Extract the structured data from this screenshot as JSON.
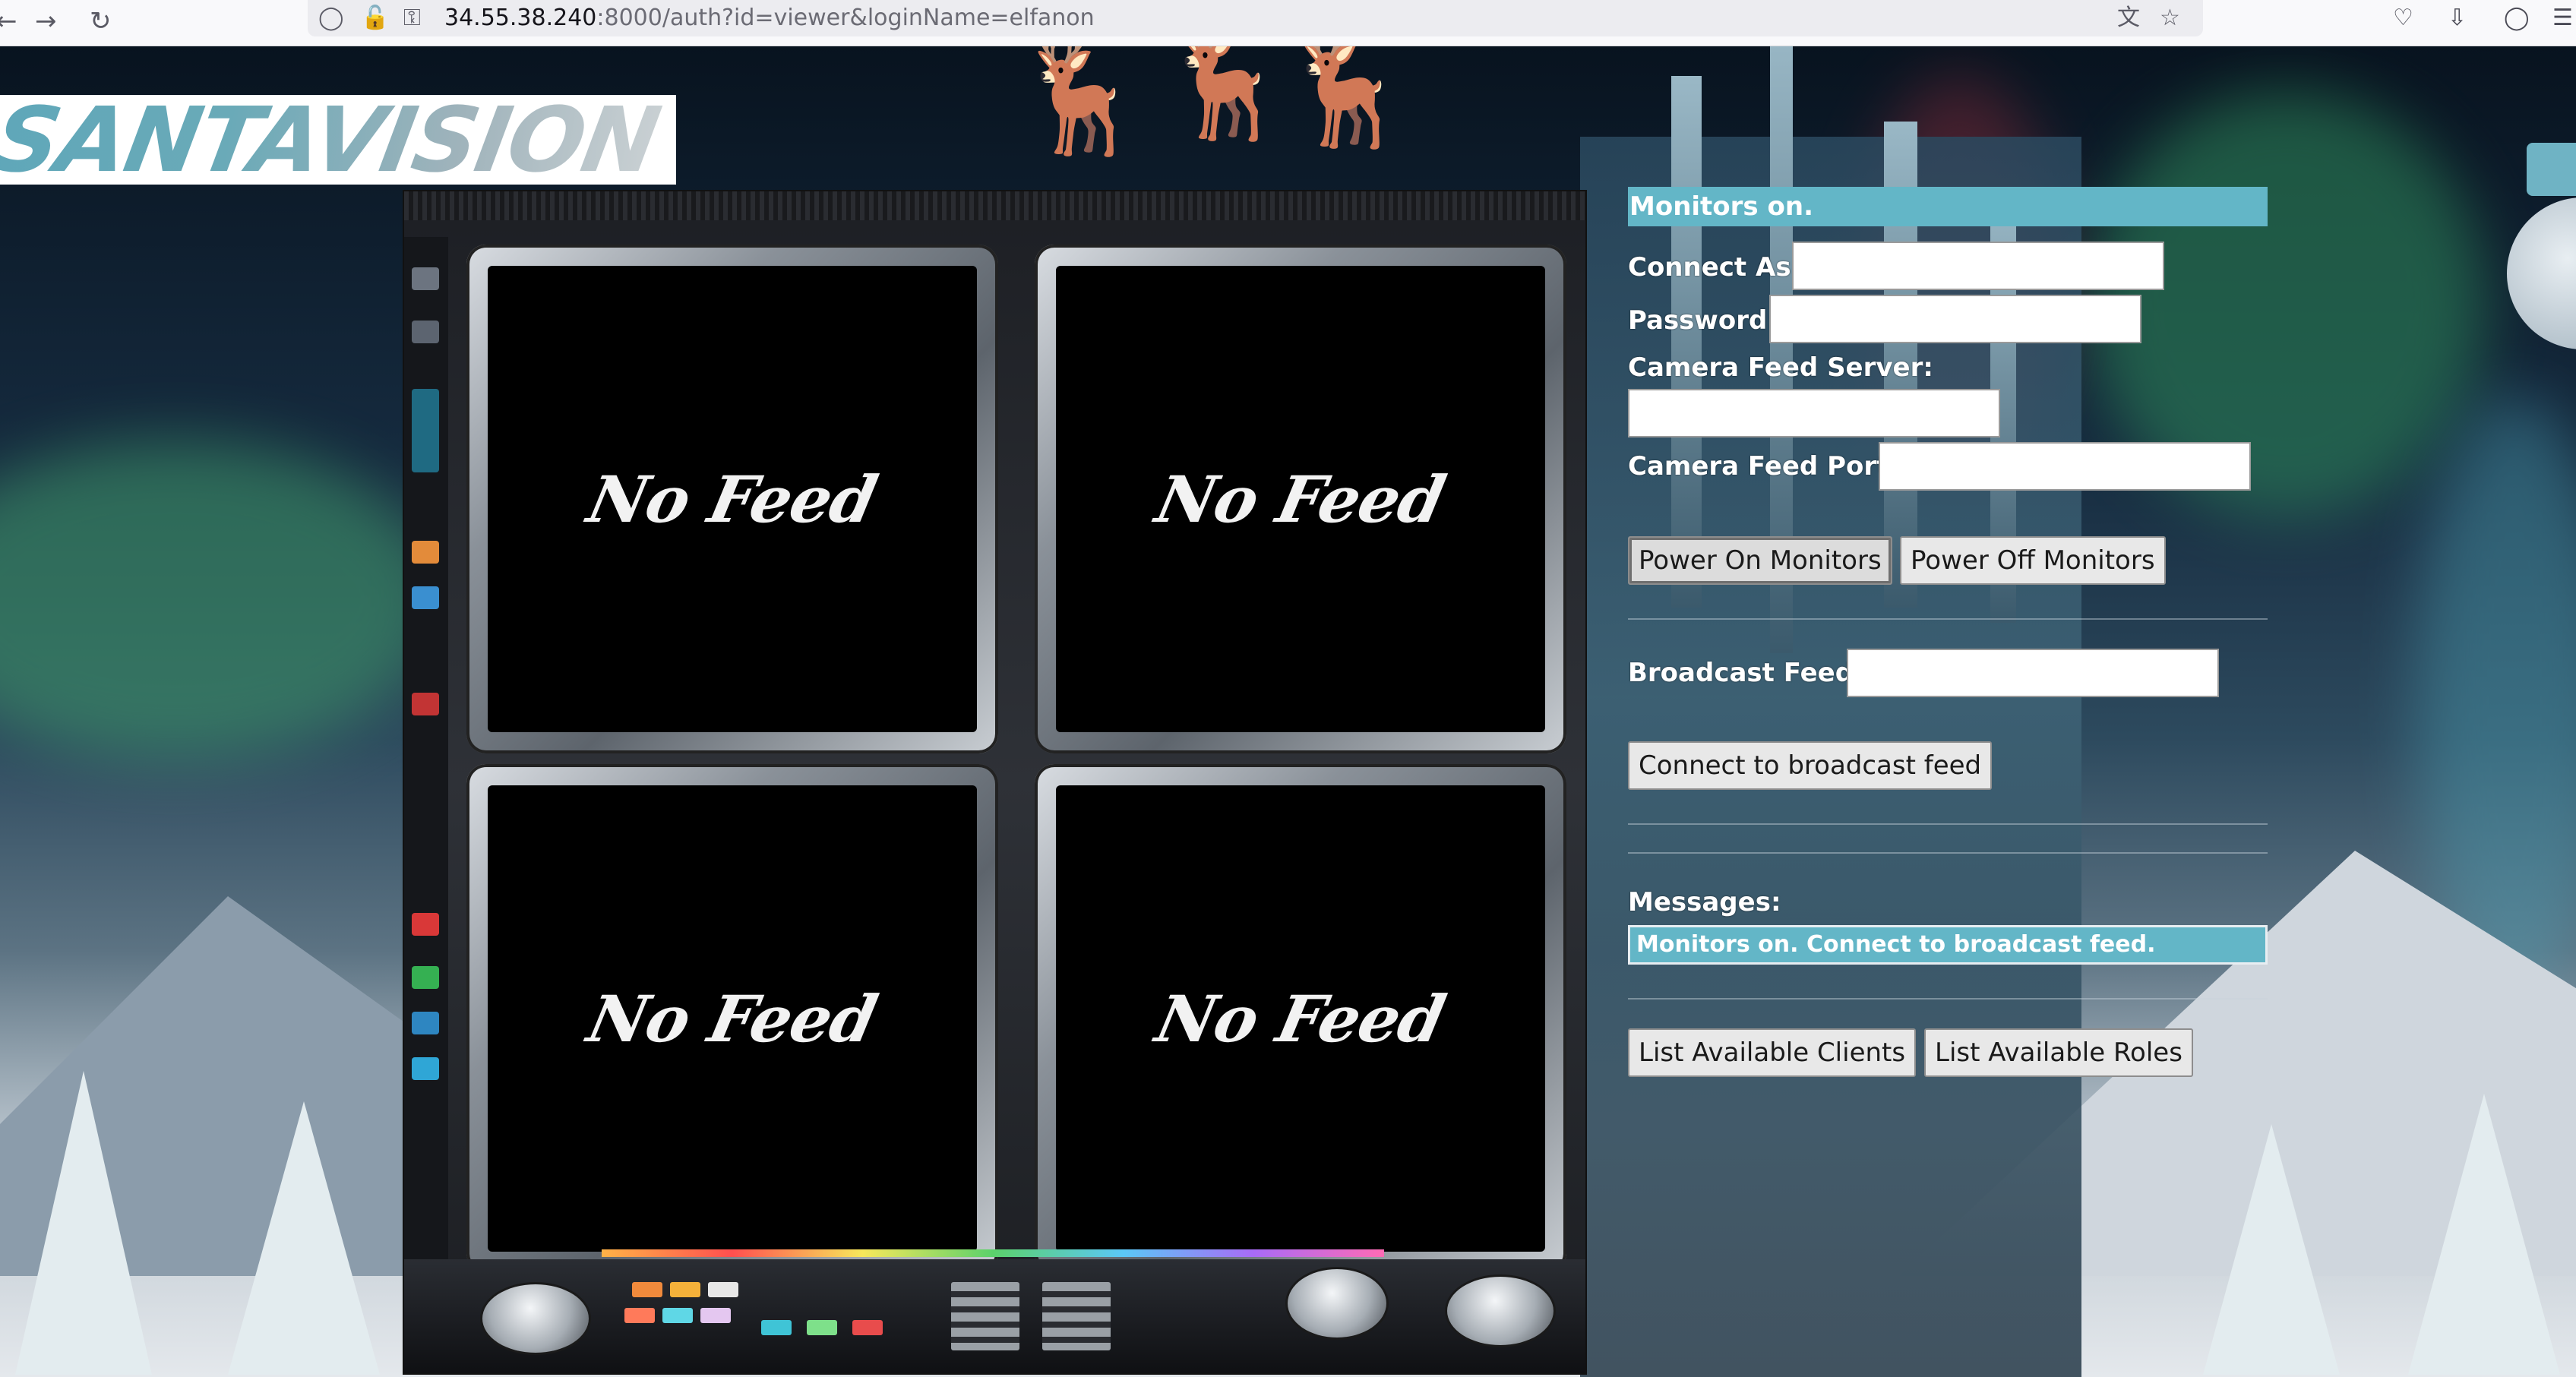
{
  "browser": {
    "url_host": "34.55.38.240",
    "url_rest": ":8000/auth?id=viewer&loginName=elfanon",
    "nav_back_icon": "back-arrow-icon",
    "nav_forward_icon": "forward-arrow-icon",
    "reload_icon": "reload-icon"
  },
  "logo": {
    "text": "SANTAVISION"
  },
  "monitors": {
    "feed_1": "No Feed",
    "feed_2": "No Feed",
    "feed_3": "No Feed",
    "feed_4": "No Feed"
  },
  "panel": {
    "status": "Monitors on.",
    "connect_as_label": "Connect As:",
    "connect_as_value": "",
    "password_label": "Password:",
    "password_value": "",
    "camera_server_label": "Camera Feed Server:",
    "camera_server_value": "",
    "camera_port_label": "Camera Feed Port:",
    "camera_port_value": "",
    "power_on_label": "Power On Monitors",
    "power_off_label": "Power Off Monitors",
    "broadcast_label": "Broadcast Feed:",
    "broadcast_value": "",
    "connect_broadcast_label": "Connect to broadcast feed",
    "messages_label": "Messages:",
    "messages_text": "Monitors on. Connect to broadcast feed.",
    "list_clients_label": "List Available Clients",
    "list_roles_label": "List Available Roles"
  },
  "colors": {
    "accent": "#63b6c7",
    "panel_text": "#ffffff",
    "button_bg": "#e8e8e8"
  }
}
